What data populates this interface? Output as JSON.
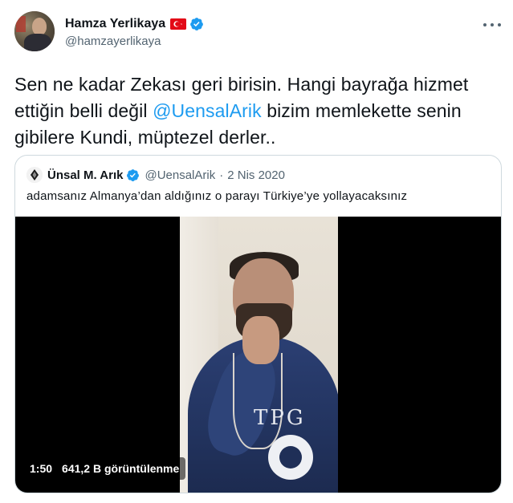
{
  "author": {
    "display_name": "Hamza Yerlikaya",
    "handle": "@hamzayerlikaya",
    "flag_icon": "turkey-flag-icon",
    "verified_icon": "verified-badge-icon"
  },
  "tweet": {
    "text_parts": [
      "Sen ne kadar Zekası geri birisin. Hangi bayrağa hizmet ettiğin belli değil ",
      "@UensalArik",
      " bizim memlekette senin gibilere Kundi, müptezel derler.."
    ]
  },
  "quoted": {
    "display_name": "Ünsal M. Arık",
    "handle": "@UensalArik",
    "separator": "·",
    "date": "2 Nis 2020",
    "text": "adamsanız Almanya’dan aldığınız o parayı Türkiye’ye yollayacaksınız",
    "video": {
      "duration": "1:50",
      "views": "641,2 B görüntülenme"
    }
  },
  "colors": {
    "accent": "#1d9bf0",
    "secondary_text": "#536471",
    "border": "#cfd9de"
  }
}
